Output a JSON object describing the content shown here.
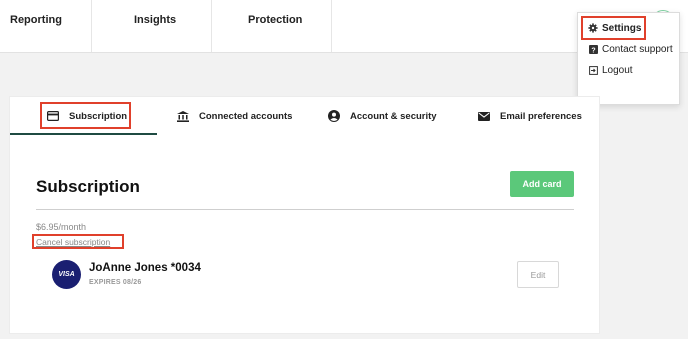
{
  "topnav": {
    "items": [
      {
        "label": "Reporting"
      },
      {
        "label": "Insights"
      },
      {
        "label": "Protection"
      }
    ]
  },
  "dropdown": {
    "items": [
      {
        "label": "Settings",
        "icon": "gear-icon"
      },
      {
        "label": "Contact support",
        "icon": "help-icon"
      },
      {
        "label": "Logout",
        "icon": "logout-icon"
      }
    ]
  },
  "tabs": [
    {
      "label": "Subscription",
      "icon": "credit-card-icon",
      "active": true
    },
    {
      "label": "Connected accounts",
      "icon": "bank-icon",
      "active": false
    },
    {
      "label": "Account & security",
      "icon": "user-circle-icon",
      "active": false
    },
    {
      "label": "Email preferences",
      "icon": "envelope-icon",
      "active": false
    }
  ],
  "subscription": {
    "title": "Subscription",
    "add_card_label": "Add card",
    "price": "$6.95/month",
    "cancel_label": "Cancel subscription"
  },
  "payment_card": {
    "brand": "VISA",
    "holder": "JoAnne Jones *0034",
    "expires": "EXPIRES 08/26",
    "edit_label": "Edit"
  },
  "colors": {
    "accent_green": "#5bc87a",
    "highlight_red": "#e0402b",
    "tab_underline": "#1f4b42",
    "visa_blue": "#1a1f71"
  }
}
